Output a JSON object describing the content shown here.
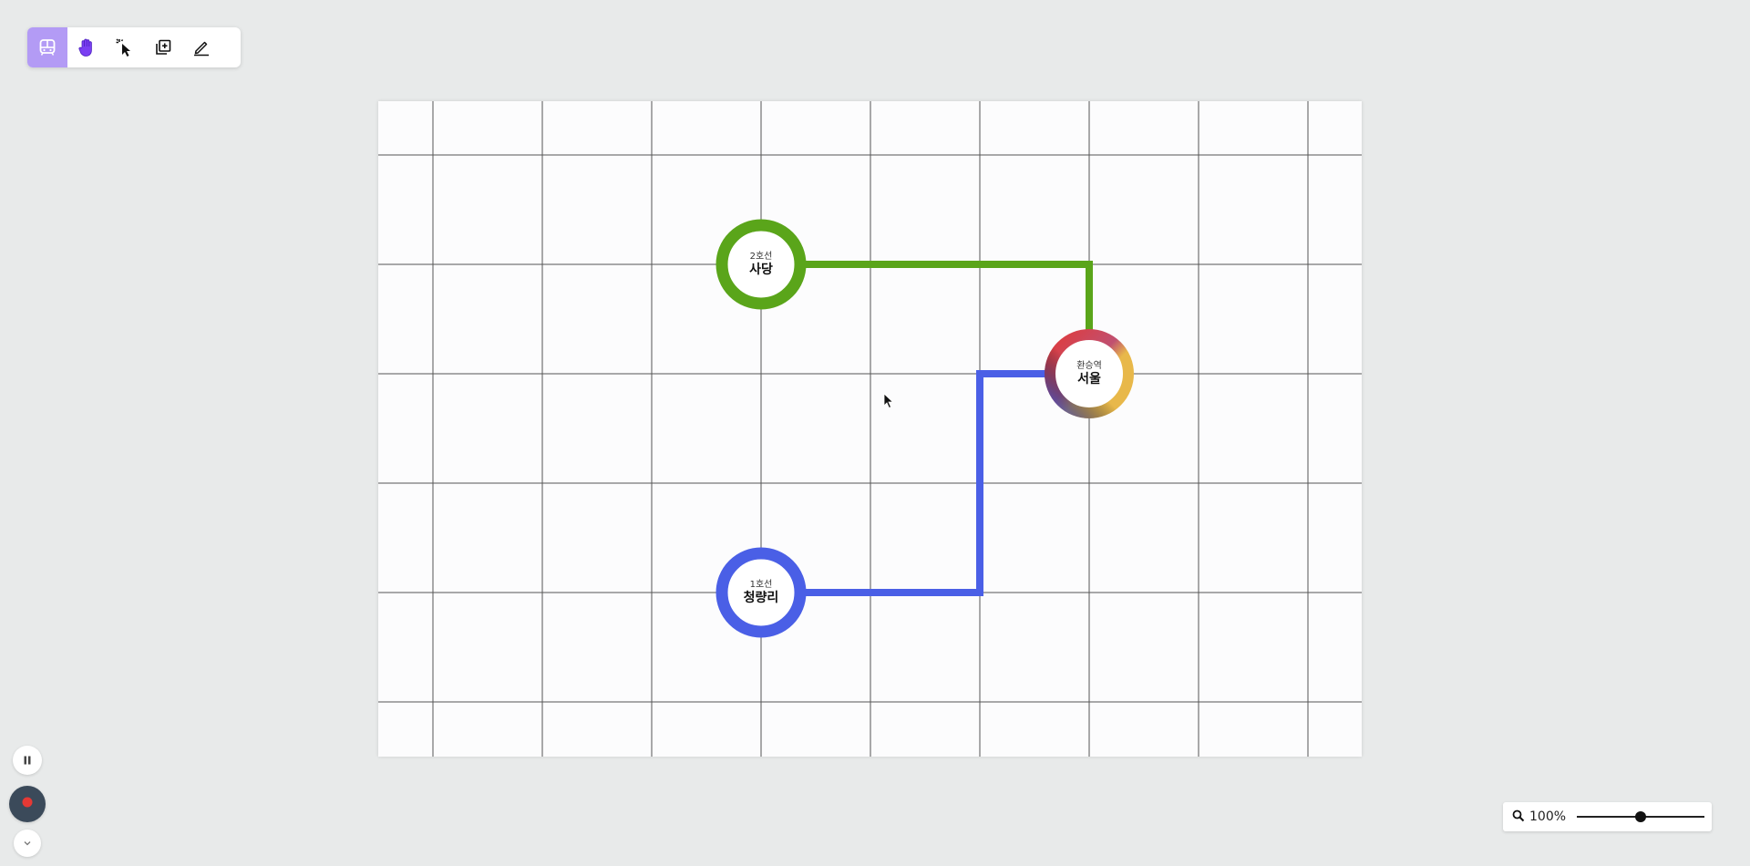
{
  "toolbar": {
    "tools": [
      {
        "icon": "metro-icon",
        "active": true
      },
      {
        "icon": "hand-icon",
        "active": false
      },
      {
        "icon": "select-cursor-icon",
        "active": false
      },
      {
        "icon": "add-layer-icon",
        "active": false
      },
      {
        "icon": "pencil-icon",
        "active": false
      }
    ]
  },
  "stations": [
    {
      "id": "sadang",
      "sub": "2호선",
      "name": "사당",
      "color": "#5aa51a"
    },
    {
      "id": "seoul",
      "sub": "환승역",
      "name": "서울",
      "colors": [
        "#e13a3a",
        "#e8b84a",
        "#5b5fd8"
      ]
    },
    {
      "id": "cheongnyangni",
      "sub": "1호선",
      "name": "청량리",
      "color": "#4a5fe6"
    }
  ],
  "lines": [
    {
      "name": "2호선",
      "color": "#5aa51a"
    },
    {
      "name": "1호선",
      "color": "#4a5fe6"
    }
  ],
  "zoom": {
    "label": "100%",
    "level": 0.5
  },
  "playback": {
    "pause_icon": "pause-icon",
    "record_icon": "record-icon",
    "expand_icon": "chevron-down-icon"
  },
  "colors": {
    "accent": "#b39bf5",
    "record": "#e53935"
  }
}
